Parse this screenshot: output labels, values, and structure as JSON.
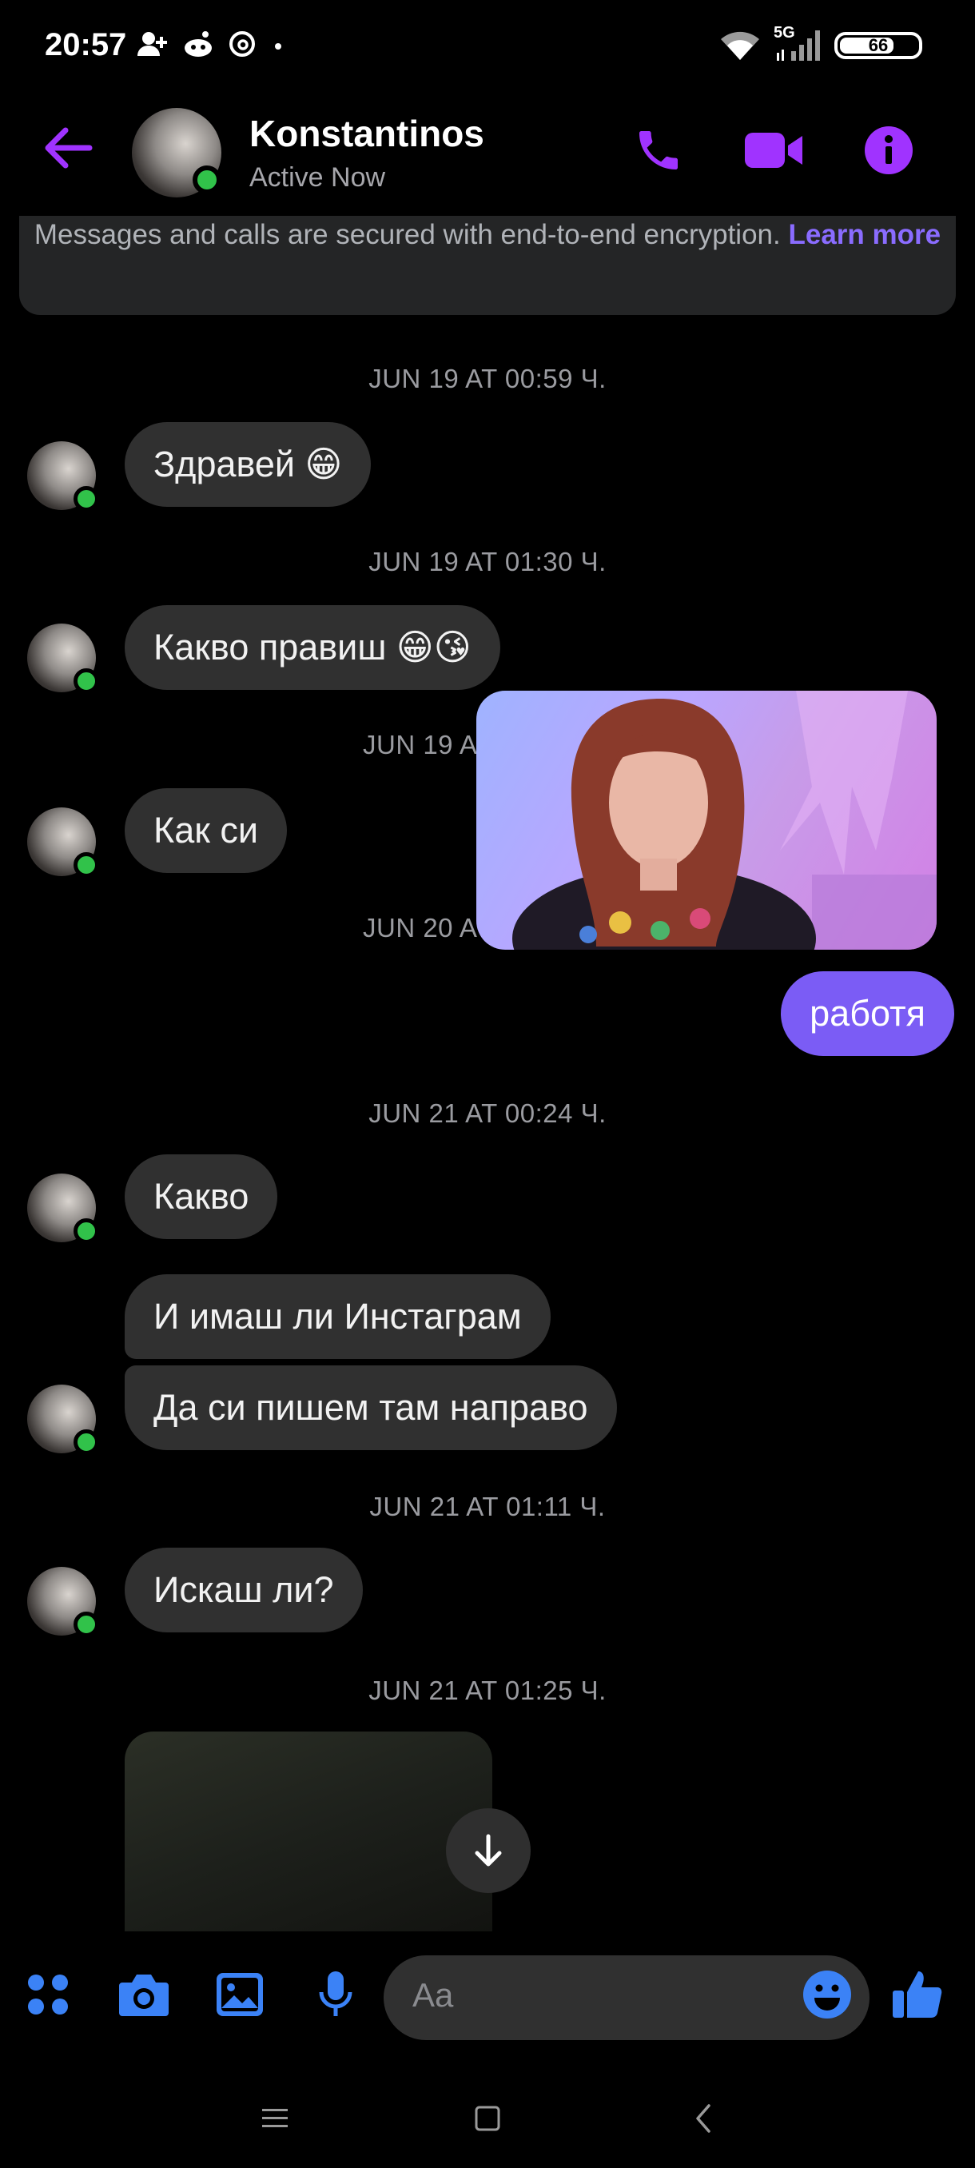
{
  "status_bar": {
    "time": "20:57",
    "network": "5G",
    "battery": "66",
    "left_icons": [
      "person-add-icon",
      "reddit-icon",
      "threads-icon",
      "dot-icon"
    ],
    "right_icons": [
      "wifi-icon",
      "signal-icon",
      "battery-icon"
    ]
  },
  "header": {
    "name": "Konstantinos",
    "status": "Active Now",
    "icons": [
      "back-arrow-icon",
      "phone-icon",
      "video-icon",
      "info-icon"
    ]
  },
  "banner": {
    "text": "Messages and calls are secured with end-to-end encryption.",
    "link": "Learn more"
  },
  "timestamps": [
    "JUN 19 AT 00:59 Ч.",
    "JUN 19 AT 01:30 Ч.",
    "JUN 19 A",
    "JUN 20 A",
    "JUN 21 AT 00:24 Ч.",
    "JUN 21 AT 01:11 Ч.",
    "JUN 21 AT 01:25 Ч."
  ],
  "messages": [
    {
      "text": "Здравей 😁",
      "sender": "them"
    },
    {
      "text": "Какво правиш 😁😘",
      "sender": "them"
    },
    {
      "text": "Как си",
      "sender": "them"
    },
    {
      "text": "работя",
      "sender": "me"
    },
    {
      "text": "Какво",
      "sender": "them"
    },
    {
      "text": "И имаш ли Инстаграм",
      "sender": "them"
    },
    {
      "text": "Да си пишем там направо",
      "sender": "them"
    },
    {
      "text": "Искаш ли?",
      "sender": "them"
    }
  ],
  "composer": {
    "placeholder": "Aa",
    "icons": [
      "apps-icon",
      "camera-icon",
      "gallery-icon",
      "microphone-icon",
      "emoji-icon",
      "thumbs-up-icon"
    ]
  },
  "colors": {
    "accent": "#a033ff",
    "sent_bubble": "#7b5cf5",
    "received_bubble": "#303030",
    "online": "#31c24a",
    "composer_icons": "#3b82f6"
  }
}
